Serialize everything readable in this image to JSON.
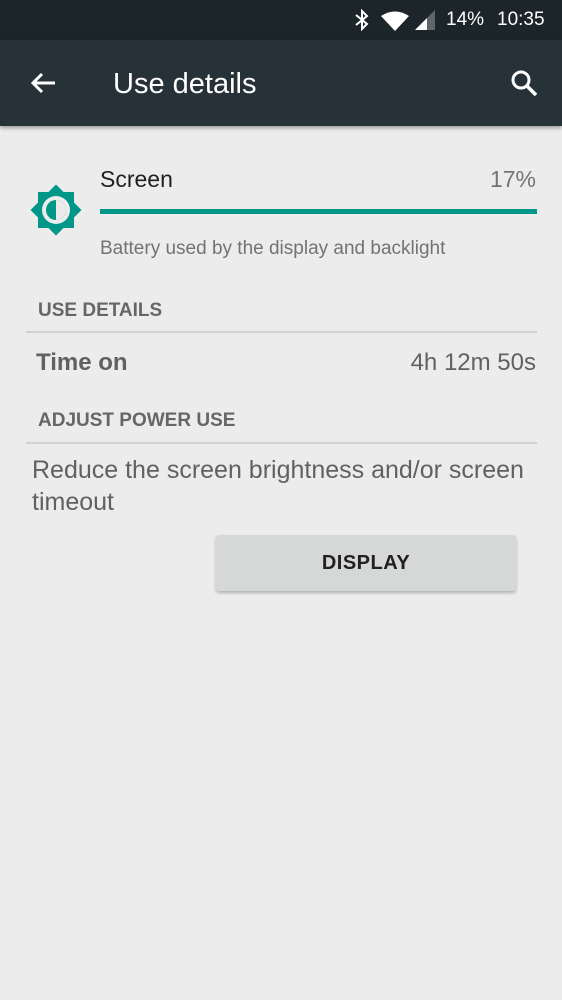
{
  "status_bar": {
    "battery_percent": "14%",
    "time": "10:35",
    "icons": [
      "bluetooth-icon",
      "wifi-icon",
      "cellular-signal-icon"
    ]
  },
  "toolbar": {
    "title": "Use details",
    "back_icon": "arrow-back-icon",
    "search_icon": "search-icon"
  },
  "screen_item": {
    "name": "Screen",
    "percent": "17%",
    "usage_fraction": 1.0,
    "description": "Battery used by the display and backlight",
    "icon": "brightness-icon",
    "accent_color": "#009688"
  },
  "use_details": {
    "header": "USE DETAILS",
    "time_on_label": "Time on",
    "time_on_value": "4h 12m 50s"
  },
  "adjust_power": {
    "header": "ADJUST POWER USE",
    "advice": "Reduce the screen brightness and/or screen timeout",
    "button_label": "DISPLAY"
  }
}
